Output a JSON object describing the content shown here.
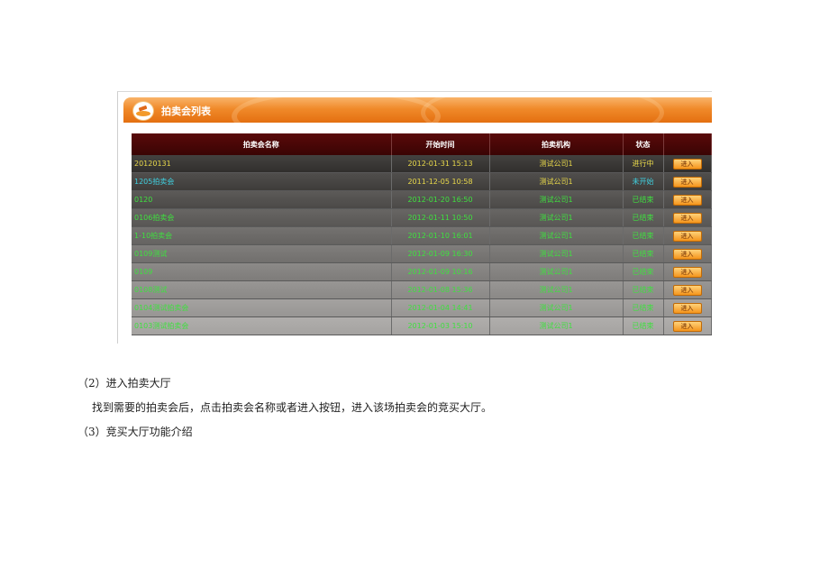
{
  "panel": {
    "title": "拍卖会列表"
  },
  "table": {
    "headers": [
      "拍卖会名称",
      "开始时间",
      "拍卖机构",
      "状态",
      ""
    ],
    "enter_label": "进入",
    "rows": [
      {
        "name": "20120131",
        "time": "2012-01-31 15:13",
        "org": "测试公司1",
        "status": "进行中",
        "name_color": "#e8d84a",
        "status_color": "#e8d84a"
      },
      {
        "name": "1205拍卖会",
        "time": "2011-12-05 10:58",
        "org": "测试公司1",
        "status": "未开始",
        "name_color": "#3fd0e0",
        "status_color": "#3fd0e0"
      },
      {
        "name": "0120",
        "time": "2012-01-20 16:50",
        "org": "测试公司1",
        "status": "已结束",
        "name_color": "#3fe03f",
        "status_color": "#3fe03f"
      },
      {
        "name": "0106拍卖会",
        "time": "2012-01-11 10:50",
        "org": "测试公司1",
        "status": "已结束",
        "name_color": "#3fe03f",
        "status_color": "#3fe03f"
      },
      {
        "name": "1-10拍卖会",
        "time": "2012-01-10 16:01",
        "org": "测试公司1",
        "status": "已结束",
        "name_color": "#3fe03f",
        "status_color": "#3fe03f"
      },
      {
        "name": "0109测试",
        "time": "2012-01-09 16:30",
        "org": "测试公司1",
        "status": "已结束",
        "name_color": "#3fe03f",
        "status_color": "#3fe03f"
      },
      {
        "name": "0109",
        "time": "2012-01-09 10:16",
        "org": "测试公司1",
        "status": "已结束",
        "name_color": "#3fe03f",
        "status_color": "#3fe03f"
      },
      {
        "name": "0108测试",
        "time": "2012-01-08 15:36",
        "org": "测试公司1",
        "status": "已结束",
        "name_color": "#3fe03f",
        "status_color": "#3fe03f"
      },
      {
        "name": "0104测试拍卖会",
        "time": "2012-01-04 14:41",
        "org": "测试公司1",
        "status": "已结束",
        "name_color": "#3fe03f",
        "status_color": "#3fe03f"
      },
      {
        "name": "0103测试拍卖会",
        "time": "2012-01-03 15:10",
        "org": "测试公司1",
        "status": "已结束",
        "name_color": "#3fe03f",
        "status_color": "#3fe03f"
      }
    ]
  },
  "doc": {
    "heading2": "（2）进入拍卖大厅",
    "para": "找到需要的拍卖会后，点击拍卖会名称或者进入按钮，进入该场拍卖会的竞买大厅。",
    "heading3": "（3）竞买大厅功能介绍"
  }
}
